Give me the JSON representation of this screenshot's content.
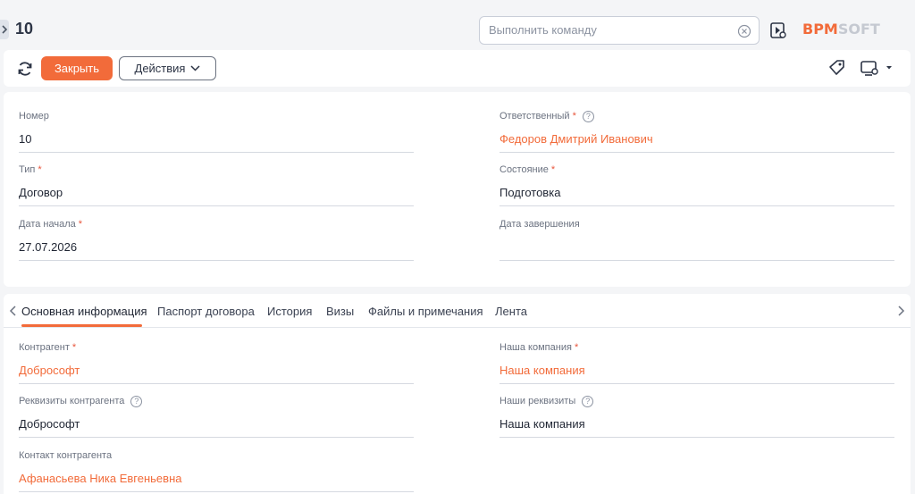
{
  "header": {
    "record_title": "10",
    "command_placeholder": "Выполнить команду",
    "logo_part1": "BPM",
    "logo_part2": "SOFT"
  },
  "toolbar": {
    "close_label": "Закрыть",
    "actions_label": "Действия"
  },
  "main": {
    "number": {
      "label": "Номер",
      "value": "10"
    },
    "type": {
      "label": "Тип",
      "value": "Договор"
    },
    "start_date": {
      "label": "Дата начала",
      "value": "27.07.2026"
    },
    "owner": {
      "label": "Ответственный",
      "value": "Федоров Дмитрий Иванович"
    },
    "state": {
      "label": "Состояние",
      "value": "Подготовка"
    },
    "end_date": {
      "label": "Дата завершения",
      "value": ""
    }
  },
  "tabs": [
    {
      "label": "Основная информация"
    },
    {
      "label": "Паспорт договора"
    },
    {
      "label": "История"
    },
    {
      "label": "Визы"
    },
    {
      "label": "Файлы и примечания"
    },
    {
      "label": "Лента"
    }
  ],
  "details": {
    "counterparty": {
      "label": "Контрагент",
      "value": "Добрософт"
    },
    "counterparty_details": {
      "label": "Реквизиты контрагента",
      "value": "Добрософт"
    },
    "counterparty_contact": {
      "label": "Контакт контрагента",
      "value": "Афанасьева Ника Евгеньевна"
    },
    "our_company": {
      "label": "Наша компания",
      "value": "Наша компания"
    },
    "our_details": {
      "label": "Наши реквизиты",
      "value": "Наша компания"
    }
  },
  "required_mark": "*",
  "help_mark": "?",
  "colors": {
    "accent": "#f26b3a",
    "required": "#e8553c"
  }
}
